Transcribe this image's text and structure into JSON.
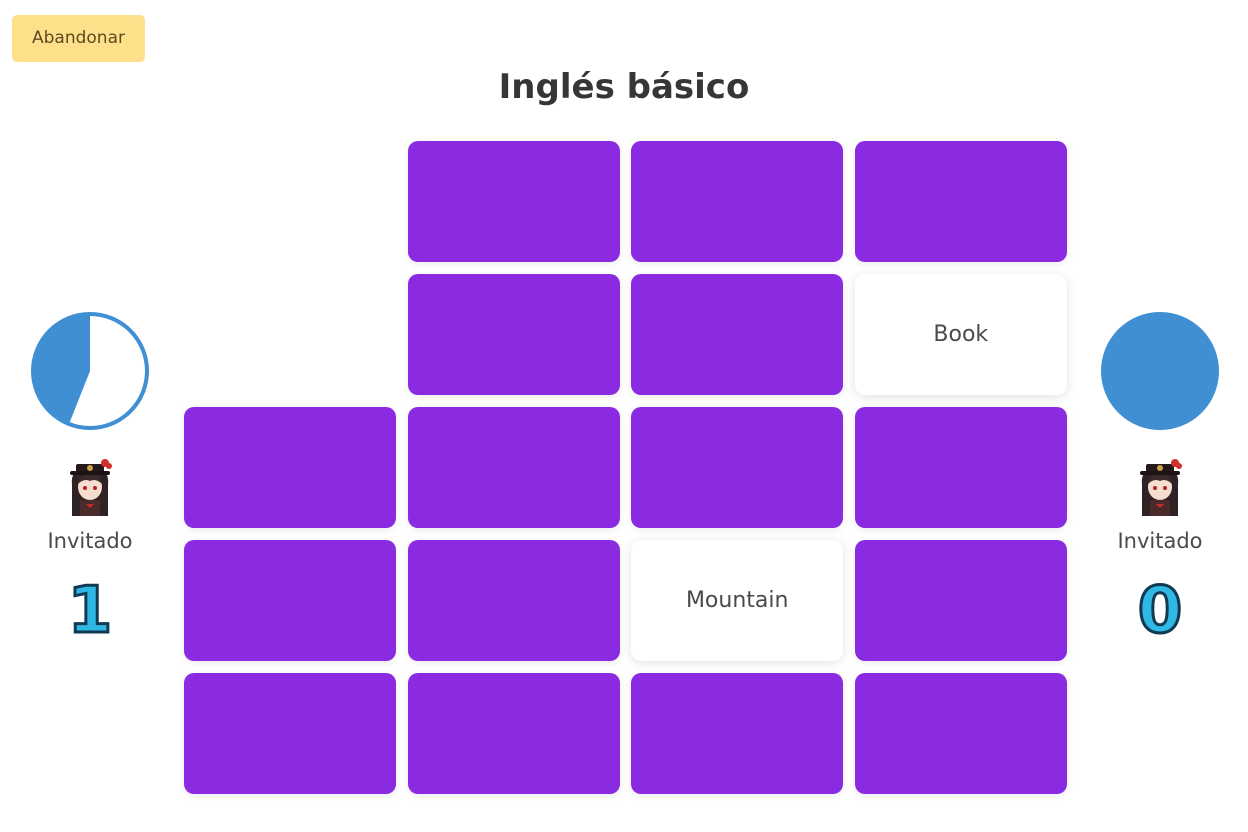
{
  "header": {
    "quit_label": "Abandonar",
    "title": "Inglés básico"
  },
  "players": [
    {
      "name": "Invitado",
      "score": "1",
      "timer_remaining": 0.44,
      "avatar_icon": "anime-character-avatar"
    },
    {
      "name": "Invitado",
      "score": "0",
      "timer_remaining": 1.0,
      "avatar_icon": "anime-character-avatar"
    }
  ],
  "colors": {
    "card_back": "#8a2be2",
    "card_face": "#ffffff",
    "timer": "#3f8fd2",
    "quit_button": "#ffe08a",
    "score_fill": "#2fb7e6",
    "score_outline": "#0f3a52"
  },
  "board": {
    "rows": 5,
    "cols": 4,
    "cards": [
      {
        "state": "empty"
      },
      {
        "state": "hidden"
      },
      {
        "state": "hidden"
      },
      {
        "state": "hidden"
      },
      {
        "state": "empty"
      },
      {
        "state": "hidden"
      },
      {
        "state": "hidden"
      },
      {
        "state": "revealed",
        "text": "Book"
      },
      {
        "state": "hidden"
      },
      {
        "state": "hidden"
      },
      {
        "state": "hidden"
      },
      {
        "state": "hidden"
      },
      {
        "state": "hidden"
      },
      {
        "state": "hidden"
      },
      {
        "state": "revealed",
        "text": "Mountain"
      },
      {
        "state": "hidden"
      },
      {
        "state": "hidden"
      },
      {
        "state": "hidden"
      },
      {
        "state": "hidden"
      },
      {
        "state": "hidden"
      }
    ]
  }
}
